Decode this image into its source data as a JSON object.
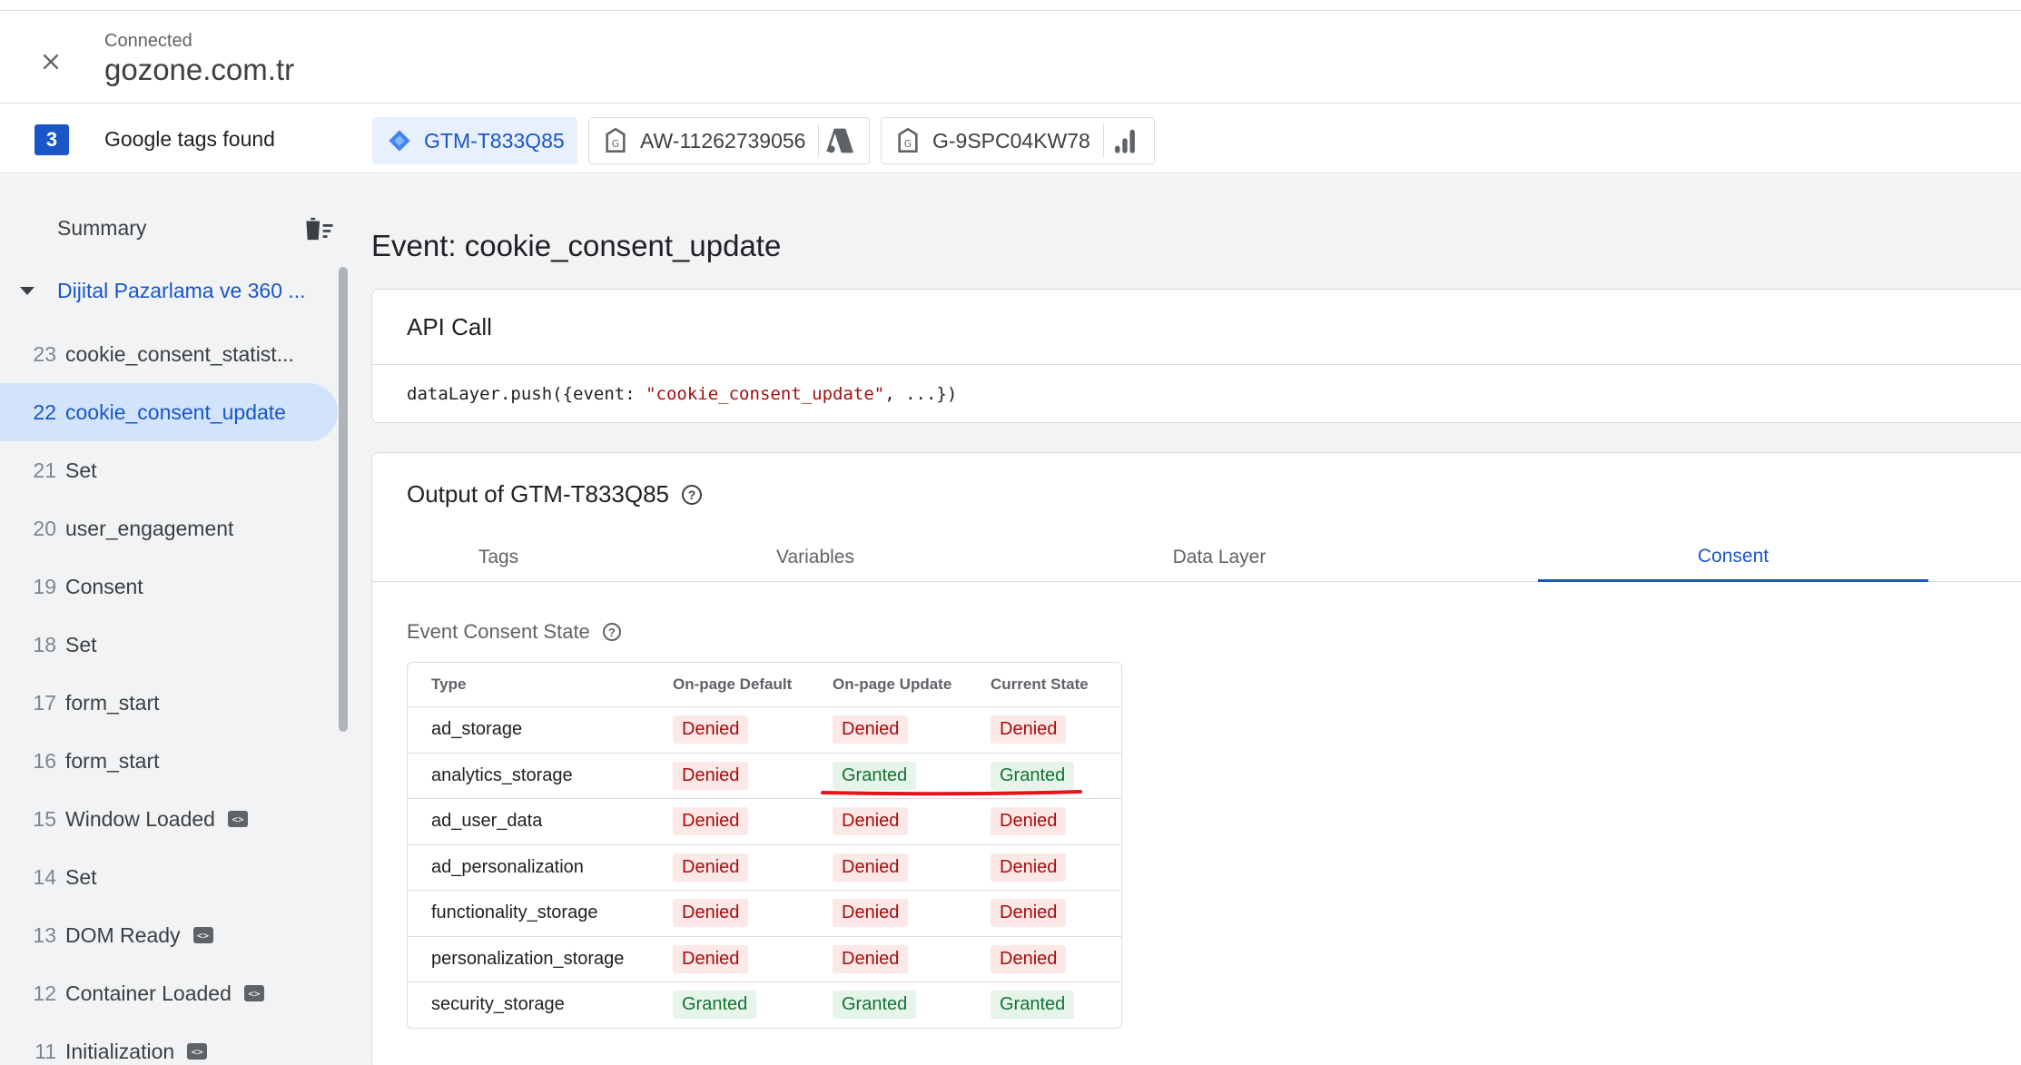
{
  "header": {
    "status": "Connected",
    "site": "gozone.com.tr"
  },
  "tagbar": {
    "count": "3",
    "found_label": "Google tags found",
    "chips": [
      {
        "id": "GTM-T833Q85",
        "icon": "gtm-diamond-icon",
        "active": true
      },
      {
        "id": "AW-11262739056",
        "icon": "google-tag-icon",
        "product_icon": "google-ads-icon"
      },
      {
        "id": "G-9SPC04KW78",
        "icon": "google-tag-icon",
        "product_icon": "google-analytics-icon"
      }
    ]
  },
  "sidebar": {
    "summary_label": "Summary",
    "container_name": "Dijital Pazarlama ve 360 ...",
    "events": [
      {
        "num": "23",
        "name": "cookie_consent_statist..."
      },
      {
        "num": "22",
        "name": "cookie_consent_update"
      },
      {
        "num": "21",
        "name": "Set"
      },
      {
        "num": "20",
        "name": "user_engagement"
      },
      {
        "num": "19",
        "name": "Consent"
      },
      {
        "num": "18",
        "name": "Set"
      },
      {
        "num": "17",
        "name": "form_start"
      },
      {
        "num": "16",
        "name": "form_start"
      },
      {
        "num": "15",
        "name": "Window Loaded"
      },
      {
        "num": "14",
        "name": "Set"
      },
      {
        "num": "13",
        "name": "DOM Ready"
      },
      {
        "num": "12",
        "name": "Container Loaded"
      },
      {
        "num": "11",
        "name": "Initialization"
      }
    ]
  },
  "main": {
    "event_title": "Event: cookie_consent_update",
    "api": {
      "heading": "API Call",
      "code_prefix": "dataLayer.push({event: ",
      "code_string": "\"cookie_consent_update\"",
      "code_suffix": ", ...})"
    },
    "output": {
      "heading": "Output of GTM-T833Q85",
      "tabs": [
        "Tags",
        "Variables",
        "Data Layer",
        "Consent"
      ],
      "active_tab": "Consent",
      "consent_heading": "Event Consent State",
      "columns": [
        "Type",
        "On-page Default",
        "On-page Update",
        "Current State"
      ],
      "rows": [
        {
          "type": "ad_storage",
          "default": "Denied",
          "update": "Denied",
          "current": "Denied"
        },
        {
          "type": "analytics_storage",
          "default": "Denied",
          "update": "Granted",
          "current": "Granted"
        },
        {
          "type": "ad_user_data",
          "default": "Denied",
          "update": "Denied",
          "current": "Denied"
        },
        {
          "type": "ad_personalization",
          "default": "Denied",
          "update": "Denied",
          "current": "Denied"
        },
        {
          "type": "functionality_storage",
          "default": "Denied",
          "update": "Denied",
          "current": "Denied"
        },
        {
          "type": "personalization_storage",
          "default": "Denied",
          "update": "Denied",
          "current": "Denied"
        },
        {
          "type": "security_storage",
          "default": "Granted",
          "update": "Granted",
          "current": "Granted"
        }
      ]
    }
  },
  "colors": {
    "accent": "#1a56c7",
    "denied_bg": "#fce8e6",
    "denied_fg": "#a50e0e",
    "granted_bg": "#e6f4ea",
    "granted_fg": "#137333",
    "annotation": "#e8121b"
  }
}
